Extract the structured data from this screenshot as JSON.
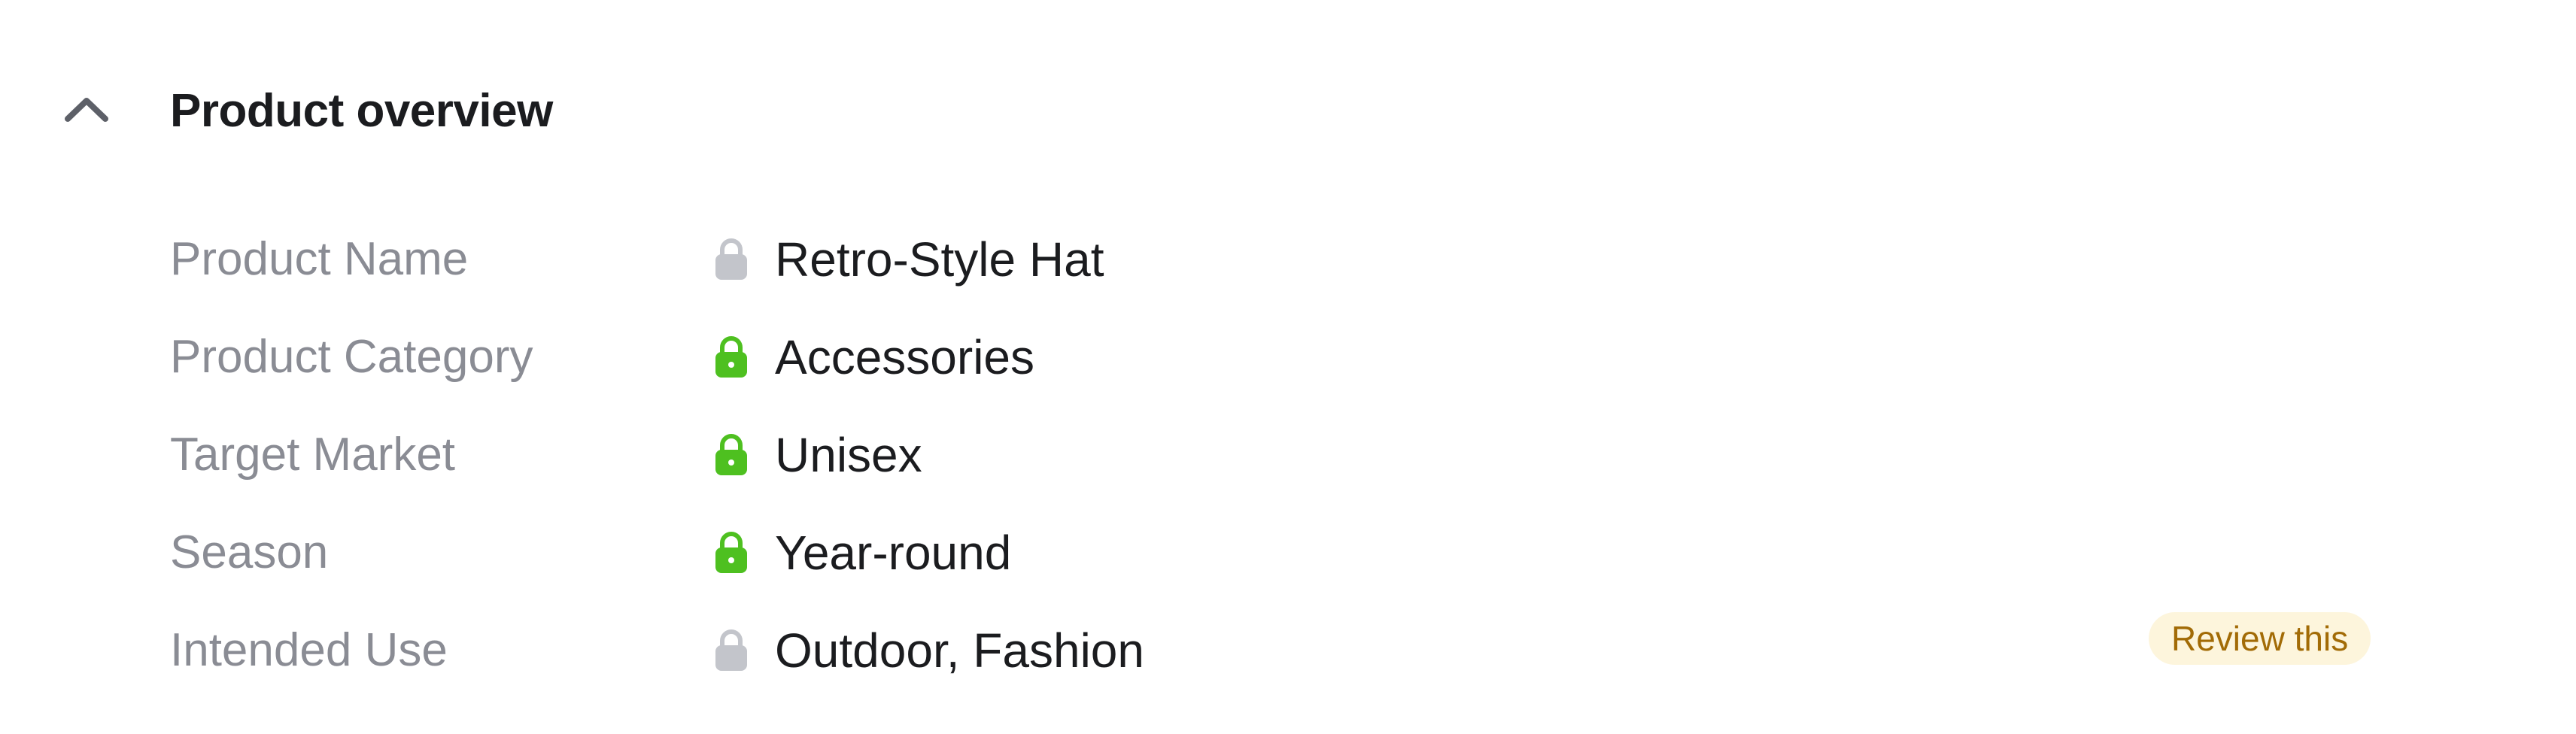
{
  "section": {
    "title": "Product overview",
    "collapse_icon": "chevron-up-icon"
  },
  "rows": [
    {
      "label": "Product Name",
      "value": "Retro-Style Hat",
      "lock_icon": "lock-icon",
      "lock_color": "#c3c5cb"
    },
    {
      "label": "Product Category",
      "value": "Accessories",
      "lock_icon": "lock-icon",
      "lock_color": "#4ec020"
    },
    {
      "label": "Target Market",
      "value": "Unisex",
      "lock_icon": "lock-icon",
      "lock_color": "#4ec020"
    },
    {
      "label": "Season",
      "value": "Year-round",
      "lock_icon": "lock-icon",
      "lock_color": "#4ec020"
    },
    {
      "label": "Intended Use",
      "value": "Outdoor, Fashion",
      "lock_icon": "lock-icon",
      "lock_color": "#c3c5cb",
      "badge": "Review this"
    }
  ],
  "colors": {
    "title": "#1b1c1f",
    "label": "#8a8c94",
    "value": "#1b1c1f",
    "lock_locked_green": "#4ec020",
    "lock_gray": "#c3c5cb",
    "badge_bg": "#fdf5dc",
    "badge_text": "#a26b06"
  }
}
